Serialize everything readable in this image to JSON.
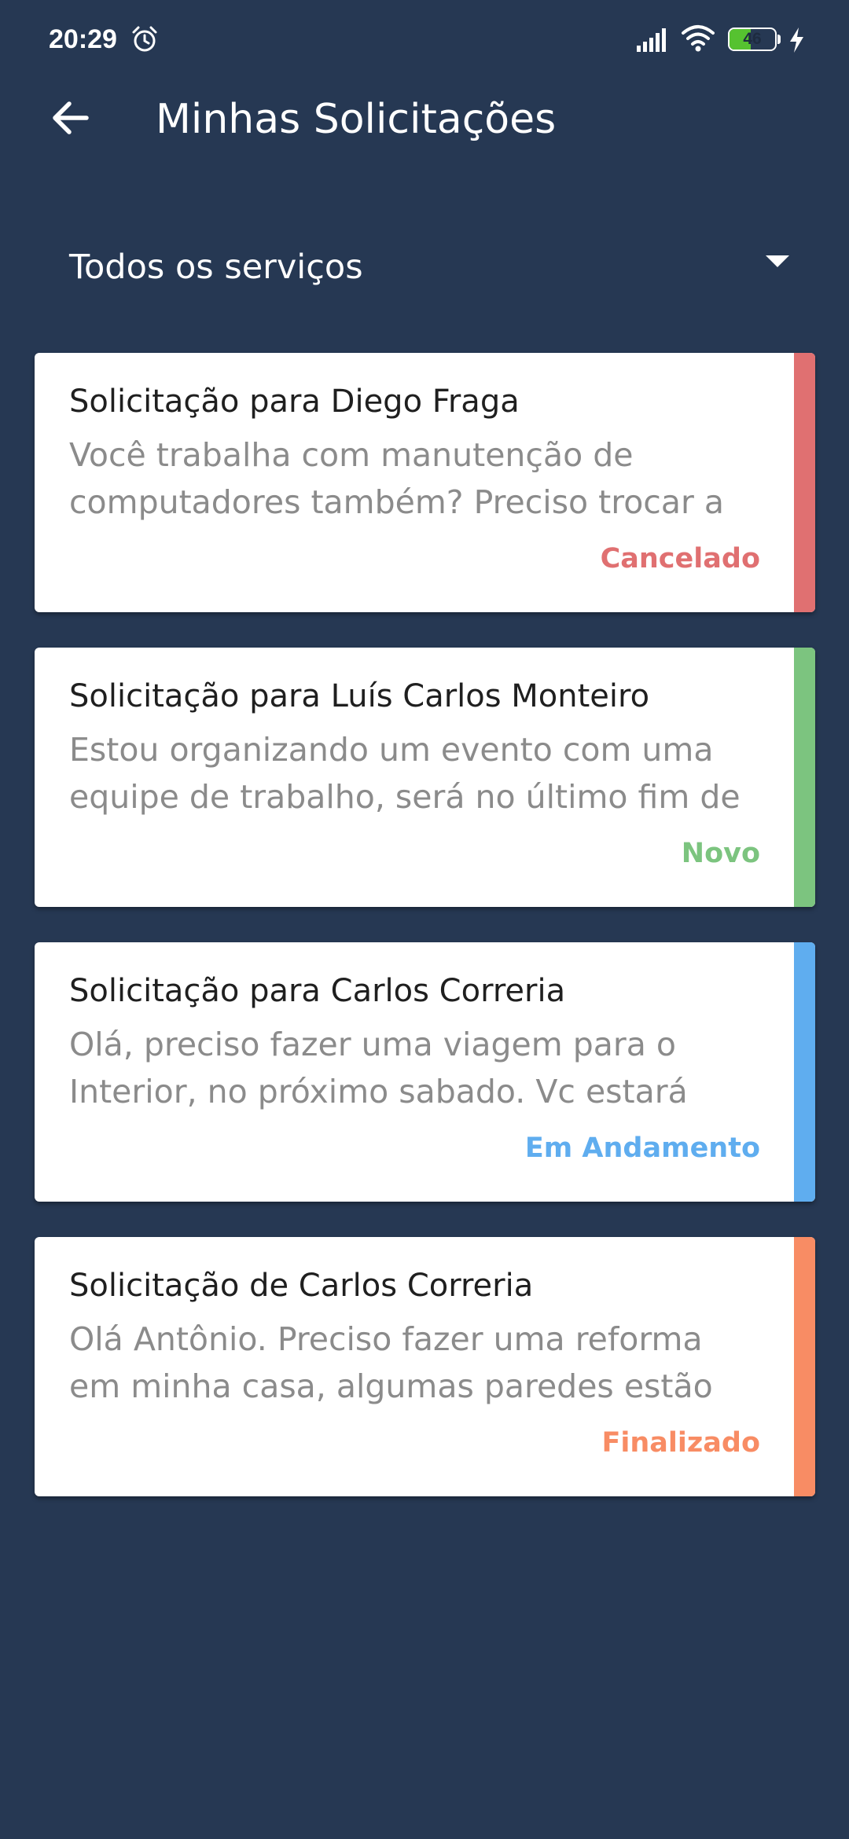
{
  "status_bar": {
    "time": "20:29",
    "battery_level": "46",
    "battery_fraction": 0.46,
    "icons": [
      "alarm-icon",
      "signal-icon",
      "wifi-icon",
      "battery-icon",
      "charging-icon"
    ]
  },
  "app_bar": {
    "back_icon": "arrow-left-icon",
    "title": "Minhas Solicitações"
  },
  "filter": {
    "selected": "Todos os serviços",
    "icon": "caret-down-icon"
  },
  "requests": [
    {
      "title": "Solicitação para Diego Fraga",
      "message_line1": "Você trabalha com manutenção de",
      "message_line2": "computadores também? Preciso trocar a",
      "status": "Cancelado",
      "color": "#e07071"
    },
    {
      "title": "Solicitação para Luís Carlos Monteiro",
      "message_line1": "Estou organizando um evento com uma",
      "message_line2": "equipe de trabalho, será no último fim de",
      "status": "Novo",
      "color": "#7cc47f"
    },
    {
      "title": "Solicitação para Carlos Correria",
      "message_line1": "Olá, preciso fazer uma viagem para o",
      "message_line2": "Interior, no próximo sabado. Vc estará",
      "status": "Em Andamento",
      "color": "#5fadef"
    },
    {
      "title": "Solicitação de Carlos Correria",
      "message_line1": "Olá Antônio. Preciso fazer uma reforma",
      "message_line2": "em minha casa, algumas paredes estão",
      "status": "Finalizado",
      "color": "#f88c64"
    }
  ],
  "colors": {
    "background": "#263853",
    "card": "#ffffff",
    "title_text": "#1f1f1f",
    "message_text": "#8b8b8b"
  }
}
